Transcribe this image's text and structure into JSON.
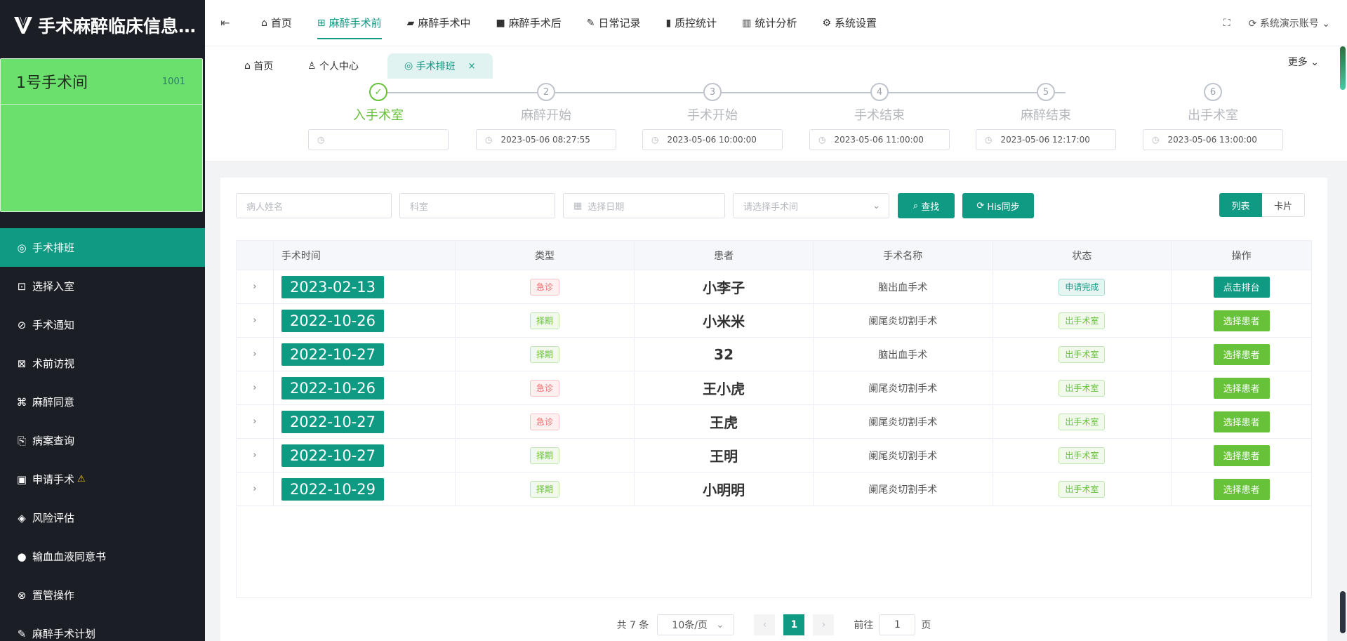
{
  "app": {
    "title": "手术麻醉临床信息管..."
  },
  "room": {
    "name": "1号手术间",
    "code": "1001",
    "color": "#6ce06c"
  },
  "sidebar": {
    "items": [
      {
        "label": "手术排班",
        "icon": "compass-icon",
        "active": true
      },
      {
        "label": "选择入室",
        "icon": "enter-icon"
      },
      {
        "label": "手术通知",
        "icon": "notice-icon"
      },
      {
        "label": "术前访视",
        "icon": "visit-icon"
      },
      {
        "label": "麻醉同意",
        "icon": "consent-icon"
      },
      {
        "label": "病案查询",
        "icon": "record-icon"
      },
      {
        "label": "申请手术",
        "icon": "apply-icon",
        "warning": "⚠"
      },
      {
        "label": "风险评估",
        "icon": "risk-icon"
      },
      {
        "label": "输血血液同意书",
        "icon": "blood-drop-icon"
      },
      {
        "label": "置管操作",
        "icon": "catheter-icon"
      },
      {
        "label": "麻醉手术计划",
        "icon": "pen-icon"
      }
    ]
  },
  "topnav": {
    "items": [
      {
        "label": "首页",
        "icon": "home-icon"
      },
      {
        "label": "麻醉手术前",
        "icon": "pre-op-icon",
        "active": true
      },
      {
        "label": "麻醉手术中",
        "icon": "battery-icon"
      },
      {
        "label": "麻醉手术后",
        "icon": "camera-icon"
      },
      {
        "label": "日常记录",
        "icon": "edit-icon"
      },
      {
        "label": "质控统计",
        "icon": "bookmark-icon"
      },
      {
        "label": "统计分析",
        "icon": "bar-chart-icon"
      },
      {
        "label": "系统设置",
        "icon": "gear-icon"
      }
    ],
    "account": "系统演示账号"
  },
  "tabs": {
    "items": [
      {
        "label": "首页"
      },
      {
        "label": "个人中心"
      },
      {
        "label": "手术排班",
        "active": true
      }
    ],
    "more": "更多"
  },
  "steps": [
    {
      "num": "1",
      "label": "入手术室",
      "value": "",
      "done": true
    },
    {
      "num": "2",
      "label": "麻醉开始",
      "value": "2023-05-06 08:27:55"
    },
    {
      "num": "3",
      "label": "手术开始",
      "value": "2023-05-06 10:00:00"
    },
    {
      "num": "4",
      "label": "手术结束",
      "value": "2023-05-06 11:00:00"
    },
    {
      "num": "5",
      "label": "麻醉结束",
      "value": "2023-05-06 12:17:00"
    },
    {
      "num": "6",
      "label": "出手术室",
      "value": "2023-05-06 13:00:00"
    }
  ],
  "filters": {
    "patient_placeholder": "病人姓名",
    "dept_placeholder": "科室",
    "date_placeholder": "选择日期",
    "room_placeholder": "请选择手术间",
    "search_label": "查找",
    "sync_label": "His同步",
    "view_list": "列表",
    "view_card": "卡片"
  },
  "table": {
    "headers": [
      "手术时间",
      "类型",
      "患者",
      "手术名称",
      "状态",
      "操作"
    ],
    "rows": [
      {
        "date": "2023-02-13",
        "type": "急诊",
        "type_style": "red",
        "patient": "小李子",
        "op": "脑出血手术",
        "status": "申请完成",
        "status_style": "teal",
        "action": "点击排台",
        "action_style": "teal"
      },
      {
        "date": "2022-10-26",
        "type": "择期",
        "type_style": "green",
        "patient": "小米米",
        "op": "阑尾炎切割手术",
        "status": "出手术室",
        "status_style": "green",
        "action": "选择患者",
        "action_style": "green"
      },
      {
        "date": "2022-10-27",
        "type": "择期",
        "type_style": "green",
        "patient": "32",
        "op": "脑出血手术",
        "status": "出手术室",
        "status_style": "green",
        "action": "选择患者",
        "action_style": "green"
      },
      {
        "date": "2022-10-26",
        "type": "急诊",
        "type_style": "red",
        "patient": "王小虎",
        "op": "阑尾炎切割手术",
        "status": "出手术室",
        "status_style": "green",
        "action": "选择患者",
        "action_style": "green"
      },
      {
        "date": "2022-10-27",
        "type": "急诊",
        "type_style": "red",
        "patient": "王虎",
        "op": "阑尾炎切割手术",
        "status": "出手术室",
        "status_style": "green",
        "action": "选择患者",
        "action_style": "green"
      },
      {
        "date": "2022-10-27",
        "type": "择期",
        "type_style": "green",
        "patient": "王明",
        "op": "阑尾炎切割手术",
        "status": "出手术室",
        "status_style": "green",
        "action": "选择患者",
        "action_style": "green"
      },
      {
        "date": "2022-10-29",
        "type": "择期",
        "type_style": "green",
        "patient": "小明明",
        "op": "阑尾炎切割手术",
        "status": "出手术室",
        "status_style": "green",
        "action": "选择患者",
        "action_style": "green"
      }
    ]
  },
  "pager": {
    "total": "共 7 条",
    "size": "10条/页",
    "page": "1",
    "goto_prefix": "前往",
    "goto_value": "1",
    "goto_suffix": "页"
  }
}
